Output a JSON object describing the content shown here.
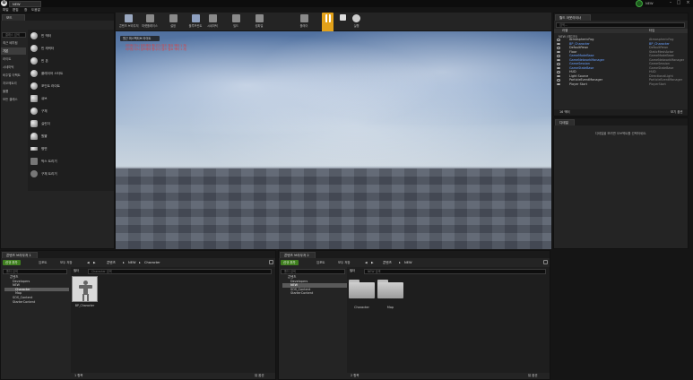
{
  "title_bar": {
    "project": "NEW",
    "status": "NEW"
  },
  "menu": [
    "파일",
    "편집",
    "창",
    "도움말"
  ],
  "modes_panel": {
    "tab": "모드",
    "search_placeholder": "클래스 검색",
    "categories": [
      "최근 배치됨",
      "기본",
      "라이트",
      "시네마틱",
      "비주얼 이펙트",
      "지오메트리",
      "볼륨",
      "모든 클래스"
    ],
    "items": [
      "빈 액터",
      "빈 캐릭터",
      "빈 폰",
      "플레이어 스타트",
      "포인트 라이트",
      "큐브",
      "구체",
      "실린더",
      "원뿔",
      "평면",
      "박스 트리거",
      "구체 트리거"
    ]
  },
  "toolbar": {
    "buttons": [
      "콘텐츠 브라우저",
      "마켓플레이스",
      "설정",
      "블루프린트",
      "시네마틱",
      "빌드",
      "컴파일",
      "플레이",
      "실행"
    ],
    "tooltip": "시뮬레이션 일시정지"
  },
  "viewport": {
    "header_btn": "원근 퍼스펙티브 라이트",
    "warn1": "라이팅 다시 빌드해야 합니다 (빌드 필요 액터 1 개)",
    "warn2": "라이팅 다시 빌드해야 합니다 (빌드 필요 액터 1 개)"
  },
  "outliner": {
    "tab": "월드 아웃라이너",
    "search_placeholder": "검색...",
    "col_label": "라벨",
    "col_type": "타입",
    "root": "NEW (에디터)",
    "rows": [
      {
        "name": "AtmosphericFog",
        "type": "AtmosphericFog"
      },
      {
        "name": "BP_Character",
        "type": "BP_Character"
      },
      {
        "name": "DefaultPawn",
        "type": "DefaultPawn"
      },
      {
        "name": "Floor",
        "type": "StaticMeshActor"
      },
      {
        "name": "GameModeBase",
        "type": "GameModeBase"
      },
      {
        "name": "GameNetworkManager",
        "type": "GameNetworkManager"
      },
      {
        "name": "GameSession",
        "type": "GameSession"
      },
      {
        "name": "GameStateBase",
        "type": "GameStateBase"
      },
      {
        "name": "HUD",
        "type": "HUD"
      },
      {
        "name": "Light Source",
        "type": "DirectionalLight"
      },
      {
        "name": "ParticleEventManager",
        "type": "ParticleEventManager"
      },
      {
        "name": "Player Start",
        "type": "PlayerStart"
      }
    ],
    "footer_count": "16 액터",
    "view_options": "보기 옵션"
  },
  "details": {
    "tab": "디테일",
    "empty_msg": "디테일을 보려면 오브젝트를 선택하세요."
  },
  "content_browser_1": {
    "tab": "콘텐츠 브라우저 1",
    "add_new": "신규 추가",
    "import": "임포트",
    "save_all": "모두 저장",
    "path": [
      "콘텐츠",
      "NEW",
      "Character"
    ],
    "search_placeholder": "폴더 검색",
    "filter": "필터",
    "asset_search_placeholder": "Character 검색",
    "tree": [
      "콘텐츠",
      "Developers",
      "NEW",
      "Character",
      "Map",
      "SOS_Content",
      "StarterContent"
    ],
    "assets": [
      "BP_Character"
    ],
    "count": "1 항목",
    "view_options": "뷰 옵션"
  },
  "content_browser_2": {
    "tab": "콘텐츠 브라우저 2",
    "add_new": "신규 추가",
    "import": "임포트",
    "save_all": "모두 저장",
    "path": [
      "콘텐츠",
      "NEW"
    ],
    "search_placeholder": "폴더 검색",
    "filter": "필터",
    "asset_search_placeholder": "NEW 검색",
    "tree": [
      "콘텐츠",
      "Developers",
      "NEW",
      "SOS_Content",
      "StarterContent"
    ],
    "assets": [
      "Character",
      "Map"
    ],
    "count": "2 항목",
    "view_options": "뷰 옵션"
  }
}
